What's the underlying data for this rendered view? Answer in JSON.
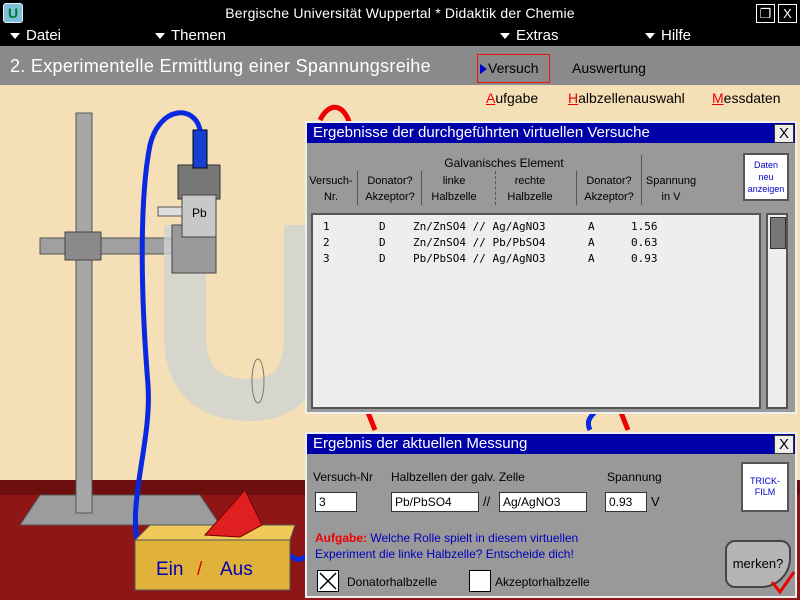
{
  "window": {
    "logo": "U",
    "title": "Bergische Universität Wuppertal   *   Didaktik der Chemie",
    "restore_glyph": "❐",
    "close_glyph": "X"
  },
  "menu": {
    "datei": "Datei",
    "themen": "Themen",
    "extras": "Extras",
    "hilfe": "Hilfe"
  },
  "header": {
    "chapter": "2. Experimentelle Ermittlung einer Spannungsreihe",
    "tab_versuch": "Versuch",
    "tab_auswertung": "Auswertung"
  },
  "sublinks": {
    "aufgabe_first": "A",
    "aufgabe_rest": "ufgabe",
    "halb_first": "H",
    "halb_rest": "albzellenauswahl",
    "mess_first": "M",
    "mess_rest": "essdaten"
  },
  "apparatus": {
    "electrode_label": "Pb",
    "switch_ein": "Ein",
    "switch_sep": "/",
    "switch_aus": "Aus"
  },
  "results_dialog": {
    "title": "Ergebnisse der durchgeführten virtuellen Versuche",
    "close": "X",
    "col_nr_1": "Versuch-",
    "col_nr_2": "Nr.",
    "col_donor_1": "Donator?",
    "col_donor_2": "Akzeptor?",
    "group_label": "Galvanisches Element",
    "col_left_1": "linke",
    "col_left_2": "Halbzelle",
    "col_right_1": "rechte",
    "col_right_2": "Halbzelle",
    "col_donor2_1": "Donator?",
    "col_donor2_2": "Akzeptor?",
    "col_volt_1": "Spannung",
    "col_volt_2": "in V",
    "refresh_1": "Daten",
    "refresh_2": "neu",
    "refresh_3": "anzeigen",
    "rows": [
      {
        "nr": "1",
        "role_left": "D",
        "cell": "Zn/ZnSO4 // Ag/AgNO3",
        "role_right": "A",
        "voltage": "1.56"
      },
      {
        "nr": "2",
        "role_left": "D",
        "cell": "Zn/ZnSO4 // Pb/PbSO4",
        "role_right": "A",
        "voltage": "0.63"
      },
      {
        "nr": "3",
        "role_left": "D",
        "cell": "Pb/PbSO4 // Ag/AgNO3",
        "role_right": "A",
        "voltage": "0.93"
      }
    ]
  },
  "measurement_dialog": {
    "title": "Ergebnis der aktuellen Messung",
    "close": "X",
    "label_nr": "Versuch-Nr",
    "label_cells": "Halbzellen der galv. Zelle",
    "label_voltage": "Spannung",
    "value_nr": "3",
    "value_left": "Pb/PbSO4",
    "separator": "//",
    "value_right": "Ag/AgNO3",
    "value_voltage": "0.93",
    "unit": "V",
    "trickfilm_1": "TRICK-",
    "trickfilm_2": "FILM",
    "task_label": "Aufgabe:",
    "task_text_1": " Welche Rolle spielt in diesem virtuellen",
    "task_text_2": "Experiment die linke Halbzelle? Entscheide dich!",
    "option_donor": "Donatorhalbzelle",
    "option_acceptor": "Akzeptorhalbzelle",
    "donor_checked": true,
    "acceptor_checked": false,
    "merken": "merken?"
  },
  "colors": {
    "background": "#f5dfb6",
    "dialog_title": "#0000aa",
    "accent_red": "#e00000",
    "wire_blue": "#0a28e0"
  }
}
